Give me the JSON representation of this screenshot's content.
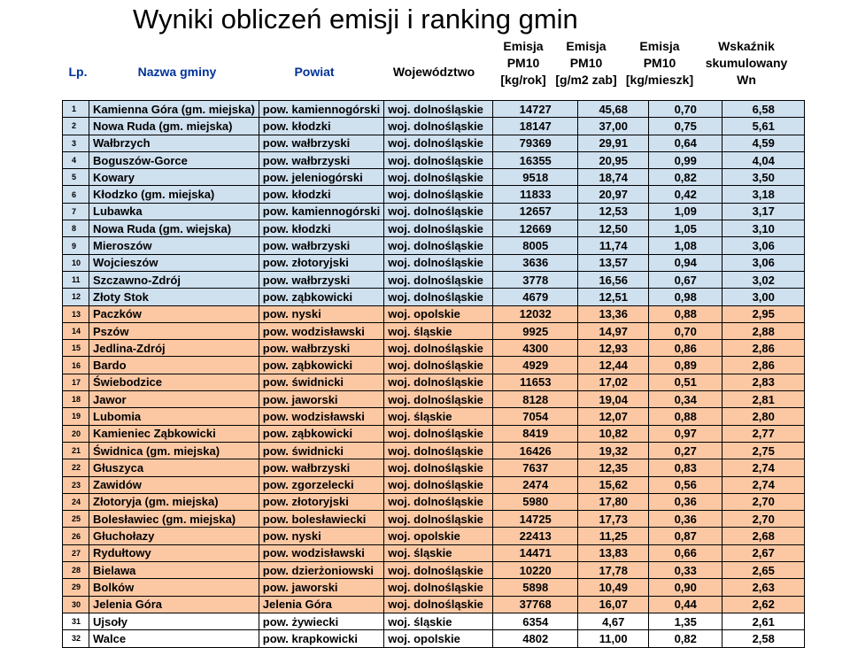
{
  "title": "Wyniki obliczeń emisji i ranking gmin",
  "headers": {
    "lp": "Lp.",
    "name": "Nazwa gminy",
    "powiat": "Powiat",
    "wojewodztwo": "Województwo",
    "e1": [
      "Emisja",
      "PM10",
      "[kg/rok]"
    ],
    "e2": [
      "Emisja",
      "PM10",
      "[g/m2 zab]"
    ],
    "e3": [
      "Emisja",
      "PM10",
      "[kg/mieszk]"
    ],
    "wn": [
      "Wskaźnik",
      "skumulowany",
      "Wn"
    ]
  },
  "colors": {
    "blue_row": "#cfe0ef",
    "orange_row": "#fcc8a4",
    "white_row": "#ffffff"
  },
  "rows": [
    {
      "lp": "1",
      "name": "Kamienna Góra (gm. miejska)",
      "powiat": "pow. kamiennogórski",
      "woj": "woj. dolnośląskie",
      "kg": "14727",
      "gm2": "45,68",
      "mieszk": "0,70",
      "wn": "6,58",
      "bg": "blue"
    },
    {
      "lp": "2",
      "name": "Nowa Ruda (gm. miejska)",
      "powiat": "pow. kłodzki",
      "woj": "woj. dolnośląskie",
      "kg": "18147",
      "gm2": "37,00",
      "mieszk": "0,75",
      "wn": "5,61",
      "bg": "blue"
    },
    {
      "lp": "3",
      "name": "Wałbrzych",
      "powiat": "pow. wałbrzyski",
      "woj": "woj. dolnośląskie",
      "kg": "79369",
      "gm2": "29,91",
      "mieszk": "0,64",
      "wn": "4,59",
      "bg": "blue"
    },
    {
      "lp": "4",
      "name": "Boguszów-Gorce",
      "powiat": "pow. wałbrzyski",
      "woj": "woj. dolnośląskie",
      "kg": "16355",
      "gm2": "20,95",
      "mieszk": "0,99",
      "wn": "4,04",
      "bg": "blue"
    },
    {
      "lp": "5",
      "name": "Kowary",
      "powiat": "pow. jeleniogórski",
      "woj": "woj. dolnośląskie",
      "kg": "9518",
      "gm2": "18,74",
      "mieszk": "0,82",
      "wn": "3,50",
      "bg": "blue"
    },
    {
      "lp": "6",
      "name": "Kłodzko (gm. miejska)",
      "powiat": "pow. kłodzki",
      "woj": "woj. dolnośląskie",
      "kg": "11833",
      "gm2": "20,97",
      "mieszk": "0,42",
      "wn": "3,18",
      "bg": "blue"
    },
    {
      "lp": "7",
      "name": "Lubawka",
      "powiat": "pow. kamiennogórski",
      "woj": "woj. dolnośląskie",
      "kg": "12657",
      "gm2": "12,53",
      "mieszk": "1,09",
      "wn": "3,17",
      "bg": "blue"
    },
    {
      "lp": "8",
      "name": "Nowa Ruda (gm. wiejska)",
      "powiat": "pow. kłodzki",
      "woj": "woj. dolnośląskie",
      "kg": "12669",
      "gm2": "12,50",
      "mieszk": "1,05",
      "wn": "3,10",
      "bg": "blue"
    },
    {
      "lp": "9",
      "name": "Mieroszów",
      "powiat": "pow. wałbrzyski",
      "woj": "woj. dolnośląskie",
      "kg": "8005",
      "gm2": "11,74",
      "mieszk": "1,08",
      "wn": "3,06",
      "bg": "blue"
    },
    {
      "lp": "10",
      "name": "Wojcieszów",
      "powiat": "pow. złotoryjski",
      "woj": "woj. dolnośląskie",
      "kg": "3636",
      "gm2": "13,57",
      "mieszk": "0,94",
      "wn": "3,06",
      "bg": "blue"
    },
    {
      "lp": "11",
      "name": "Szczawno-Zdrój",
      "powiat": "pow. wałbrzyski",
      "woj": "woj. dolnośląskie",
      "kg": "3778",
      "gm2": "16,56",
      "mieszk": "0,67",
      "wn": "3,02",
      "bg": "blue"
    },
    {
      "lp": "12",
      "name": "Złoty Stok",
      "powiat": "pow. ząbkowicki",
      "woj": "woj. dolnośląskie",
      "kg": "4679",
      "gm2": "12,51",
      "mieszk": "0,98",
      "wn": "3,00",
      "bg": "blue"
    },
    {
      "lp": "13",
      "name": "Paczków",
      "powiat": "pow. nyski",
      "woj": "woj. opolskie",
      "kg": "12032",
      "gm2": "13,36",
      "mieszk": "0,88",
      "wn": "2,95",
      "bg": "orange"
    },
    {
      "lp": "14",
      "name": "Pszów",
      "powiat": "pow. wodzisławski",
      "woj": "woj. śląskie",
      "kg": "9925",
      "gm2": "14,97",
      "mieszk": "0,70",
      "wn": "2,88",
      "bg": "orange"
    },
    {
      "lp": "15",
      "name": "Jedlina-Zdrój",
      "powiat": "pow. wałbrzyski",
      "woj": "woj. dolnośląskie",
      "kg": "4300",
      "gm2": "12,93",
      "mieszk": "0,86",
      "wn": "2,86",
      "bg": "orange"
    },
    {
      "lp": "16",
      "name": "Bardo",
      "powiat": "pow. ząbkowicki",
      "woj": "woj. dolnośląskie",
      "kg": "4929",
      "gm2": "12,44",
      "mieszk": "0,89",
      "wn": "2,86",
      "bg": "orange"
    },
    {
      "lp": "17",
      "name": "Świebodzice",
      "powiat": "pow. świdnicki",
      "woj": "woj. dolnośląskie",
      "kg": "11653",
      "gm2": "17,02",
      "mieszk": "0,51",
      "wn": "2,83",
      "bg": "orange"
    },
    {
      "lp": "18",
      "name": "Jawor",
      "powiat": "pow. jaworski",
      "woj": "woj. dolnośląskie",
      "kg": "8128",
      "gm2": "19,04",
      "mieszk": "0,34",
      "wn": "2,81",
      "bg": "orange"
    },
    {
      "lp": "19",
      "name": "Lubomia",
      "powiat": "pow. wodzisławski",
      "woj": "woj. śląskie",
      "kg": "7054",
      "gm2": "12,07",
      "mieszk": "0,88",
      "wn": "2,80",
      "bg": "orange"
    },
    {
      "lp": "20",
      "name": "Kamieniec Ząbkowicki",
      "powiat": "pow. ząbkowicki",
      "woj": "woj. dolnośląskie",
      "kg": "8419",
      "gm2": "10,82",
      "mieszk": "0,97",
      "wn": "2,77",
      "bg": "orange"
    },
    {
      "lp": "21",
      "name": "Świdnica (gm. miejska)",
      "powiat": "pow. świdnicki",
      "woj": "woj. dolnośląskie",
      "kg": "16426",
      "gm2": "19,32",
      "mieszk": "0,27",
      "wn": "2,75",
      "bg": "orange"
    },
    {
      "lp": "22",
      "name": "Głuszyca",
      "powiat": "pow. wałbrzyski",
      "woj": "woj. dolnośląskie",
      "kg": "7637",
      "gm2": "12,35",
      "mieszk": "0,83",
      "wn": "2,74",
      "bg": "orange"
    },
    {
      "lp": "23",
      "name": "Zawidów",
      "powiat": "pow. zgorzelecki",
      "woj": "woj. dolnośląskie",
      "kg": "2474",
      "gm2": "15,62",
      "mieszk": "0,56",
      "wn": "2,74",
      "bg": "orange"
    },
    {
      "lp": "24",
      "name": "Złotoryja (gm. miejska)",
      "powiat": "pow. złotoryjski",
      "woj": "woj. dolnośląskie",
      "kg": "5980",
      "gm2": "17,80",
      "mieszk": "0,36",
      "wn": "2,70",
      "bg": "orange"
    },
    {
      "lp": "25",
      "name": "Bolesławiec (gm. miejska)",
      "powiat": "pow. bolesławiecki",
      "woj": "woj. dolnośląskie",
      "kg": "14725",
      "gm2": "17,73",
      "mieszk": "0,36",
      "wn": "2,70",
      "bg": "orange"
    },
    {
      "lp": "26",
      "name": "Głuchołazy",
      "powiat": "pow. nyski",
      "woj": "woj. opolskie",
      "kg": "22413",
      "gm2": "11,25",
      "mieszk": "0,87",
      "wn": "2,68",
      "bg": "orange"
    },
    {
      "lp": "27",
      "name": "Rydułtowy",
      "powiat": "pow. wodzisławski",
      "woj": "woj. śląskie",
      "kg": "14471",
      "gm2": "13,83",
      "mieszk": "0,66",
      "wn": "2,67",
      "bg": "orange"
    },
    {
      "lp": "28",
      "name": "Bielawa",
      "powiat": "pow. dzierżoniowski",
      "woj": "woj. dolnośląskie",
      "kg": "10220",
      "gm2": "17,78",
      "mieszk": "0,33",
      "wn": "2,65",
      "bg": "orange"
    },
    {
      "lp": "29",
      "name": "Bolków",
      "powiat": "pow. jaworski",
      "woj": "woj. dolnośląskie",
      "kg": "5898",
      "gm2": "10,49",
      "mieszk": "0,90",
      "wn": "2,63",
      "bg": "orange"
    },
    {
      "lp": "30",
      "name": "Jelenia Góra",
      "powiat": "Jelenia Góra",
      "woj": "woj. dolnośląskie",
      "kg": "37768",
      "gm2": "16,07",
      "mieszk": "0,44",
      "wn": "2,62",
      "bg": "orange"
    },
    {
      "lp": "31",
      "name": "Ujsoły",
      "powiat": "pow. żywiecki",
      "woj": "woj. śląskie",
      "kg": "6354",
      "gm2": "4,67",
      "mieszk": "1,35",
      "wn": "2,61",
      "bg": "white"
    },
    {
      "lp": "32",
      "name": "Walce",
      "powiat": "pow. krapkowicki",
      "woj": "woj. opolskie",
      "kg": "4802",
      "gm2": "11,00",
      "mieszk": "0,82",
      "wn": "2,58",
      "bg": "white"
    }
  ]
}
